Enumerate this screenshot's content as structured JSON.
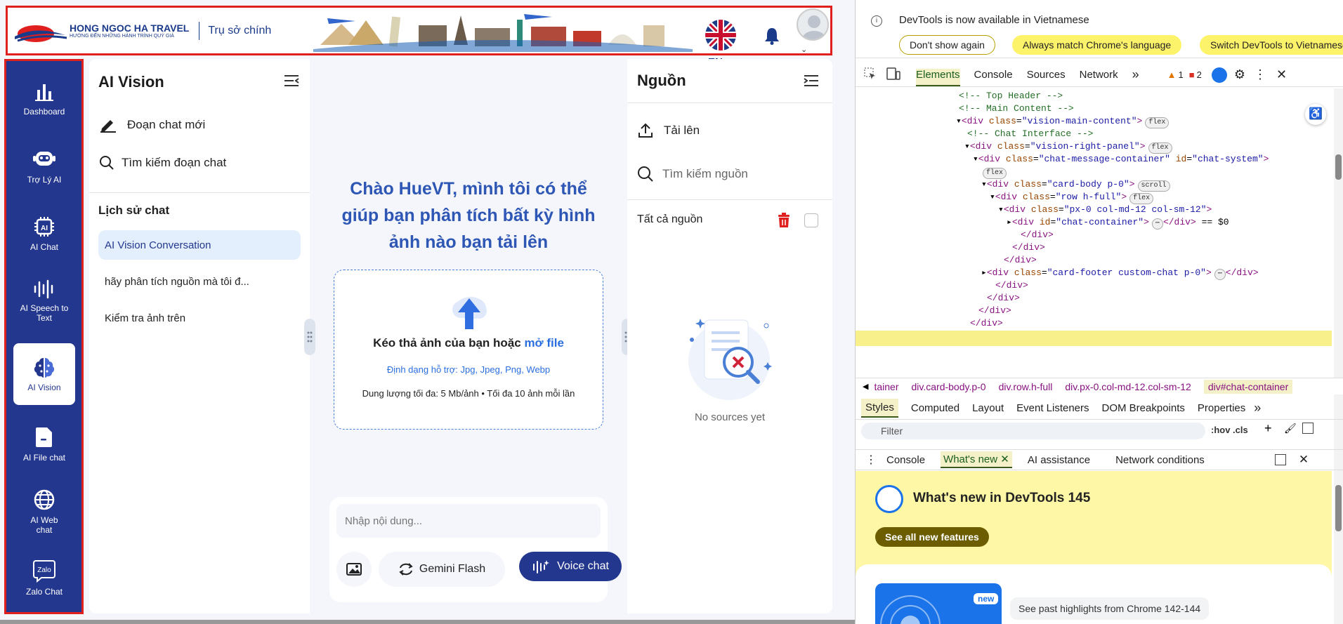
{
  "header": {
    "brand_name": "HONG NGOC HA TRAVEL",
    "brand_tagline": "HƯỚNG ĐẾN NHỮNG HÀNH TRÌNH QUÝ GIÁ",
    "office": "Trụ sở chính",
    "language": "EN"
  },
  "sidebar": {
    "items": [
      {
        "label": "Dashboard",
        "icon": "bar-chart-icon"
      },
      {
        "label": "Trợ Lý AI",
        "icon": "robot-icon"
      },
      {
        "label": "AI Chat",
        "icon": "ai-chip-icon"
      },
      {
        "label": "AI Speech to Text",
        "icon": "waveform-icon"
      },
      {
        "label": "AI Vision",
        "icon": "brain-icon"
      },
      {
        "label": "AI File chat",
        "icon": "file-icon"
      },
      {
        "label": "AI Web chat",
        "icon": "globe-icon"
      },
      {
        "label": "Zalo Chat",
        "icon": "zalo-icon"
      }
    ]
  },
  "vision_panel": {
    "title": "AI Vision",
    "new_chat": "Đoạn chat mới",
    "search_chat": "Tìm kiếm đoạn chat",
    "history_title": "Lịch sử chat",
    "history": [
      "AI Vision Conversation",
      "hãy phân tích nguồn mà tôi đ...",
      "Kiểm tra ảnh trên"
    ]
  },
  "center": {
    "greeting": "Chào HueVT, mình tôi có thể giúp bạn phân tích bất kỳ hình ảnh nào bạn tải lên",
    "drop_text": "Kéo thả ảnh của bạn hoặc ",
    "drop_link": "mở file",
    "formats": "Định dạng hỗ trợ: Jpg, Jpeg, Png, Webp",
    "limits": "Dung lượng tối đa: 5 Mb/ảnh • Tối đa 10 ảnh mỗi lần",
    "input_placeholder": "Nhập nội dung...",
    "model": "Gemini Flash",
    "voice": "Voice chat"
  },
  "sources": {
    "title": "Nguồn",
    "upload": "Tải lên",
    "search": "Tìm kiếm nguồn",
    "all": "Tất cả nguồn",
    "empty": "No sources yet"
  },
  "devtools": {
    "info": "DevTools is now available in Vietnamese",
    "btn_dont_show": "Don't show again",
    "btn_match": "Always match Chrome's language",
    "btn_switch": "Switch DevTools to Vietnamese",
    "tabs": [
      "Elements",
      "Console",
      "Sources",
      "Network"
    ],
    "warnings": "1",
    "errors": "2",
    "code_lines": [
      {
        "indent": 150,
        "html": "<span class='c-cm'>&lt;!-- Top Header --&gt;</span>"
      },
      {
        "indent": 150,
        "html": "<span class='c-cm'>&lt;!-- Main Content --&gt;</span>"
      },
      {
        "indent": 146,
        "html": "▾<span class='c-tag'>&lt;div</span> <span class='c-attr'>class</span>=<span class='c-val'>\"vision-main-content\"</span><span class='c-tag'>&gt;</span><span class='c-badge'>flex</span>"
      },
      {
        "indent": 162,
        "html": "<span class='c-cm'>&lt;!-- Chat Interface --&gt;</span>"
      },
      {
        "indent": 158,
        "html": "▾<span class='c-tag'>&lt;div</span> <span class='c-attr'>class</span>=<span class='c-val'>\"vision-right-panel\"</span><span class='c-tag'>&gt;</span><span class='c-badge'>flex</span>"
      },
      {
        "indent": 170,
        "html": "▾<span class='c-tag'>&lt;div</span> <span class='c-attr'>class</span>=<span class='c-val'>\"chat-message-container\"</span> <span class='c-attr'>id</span>=<span class='c-val'>\"chat-system\"</span><span class='c-tag'>&gt;</span>"
      },
      {
        "indent": 180,
        "html": "<span class='c-badge'>flex</span>"
      },
      {
        "indent": 182,
        "html": "▾<span class='c-tag'>&lt;div</span> <span class='c-attr'>class</span>=<span class='c-val'>\"card-body p-0\"</span><span class='c-tag'>&gt;</span><span class='c-badge'>scroll</span>"
      },
      {
        "indent": 194,
        "html": "▾<span class='c-tag'>&lt;div</span> <span class='c-attr'>class</span>=<span class='c-val'>\"row h-full\"</span><span class='c-tag'>&gt;</span><span class='c-badge'>flex</span>"
      },
      {
        "indent": 206,
        "html": "▾<span class='c-tag'>&lt;div</span> <span class='c-attr'>class</span>=<span class='c-val'>\"px-0 col-md-12 col-sm-12\"</span><span class='c-tag'>&gt;</span>"
      },
      {
        "indent": 218,
        "html": "▸<span class='c-tag'>&lt;div</span> <span class='c-attr'>id</span>=<span class='c-val'>\"chat-container\"</span><span class='c-tag'>&gt;</span><span class='c-badge'>⋯</span><span class='c-tag'>&lt;/div&gt;</span> == $0"
      },
      {
        "indent": 238,
        "html": "<span class='c-tag'>&lt;/div&gt;</span>"
      },
      {
        "indent": 226,
        "html": "<span class='c-tag'>&lt;/div&gt;</span>"
      },
      {
        "indent": 214,
        "html": "<span class='c-tag'>&lt;/div&gt;</span>"
      },
      {
        "indent": 182,
        "html": "▸<span class='c-tag'>&lt;div</span> <span class='c-attr'>class</span>=<span class='c-val'>\"card-footer custom-chat p-0\"</span><span class='c-tag'>&gt;</span><span class='c-badge'>⋯</span><span class='c-tag'>&lt;/div&gt;</span>"
      },
      {
        "indent": 202,
        "html": "<span class='c-tag'>&lt;/div&gt;</span>"
      },
      {
        "indent": 190,
        "html": "<span class='c-tag'>&lt;/div&gt;</span>"
      },
      {
        "indent": 178,
        "html": "<span class='c-tag'>&lt;/div&gt;</span>"
      },
      {
        "indent": 166,
        "html": "<span class='c-tag'>&lt;/div&gt;</span>"
      }
    ],
    "crumbs": [
      "tainer",
      "div.card-body.p-0",
      "div.row.h-full",
      "div.px-0.col-md-12.col-sm-12",
      "div#chat-container"
    ],
    "subtabs": [
      "Styles",
      "Computed",
      "Layout",
      "Event Listeners",
      "DOM Breakpoints",
      "Properties"
    ],
    "filter": "Filter",
    "hovcls": ":hov .cls",
    "drawer_tabs": [
      "Console",
      "What's new",
      "AI assistance",
      "Network conditions"
    ],
    "whats_new_title": "What's new in DevTools 145",
    "see_all": "See all new features",
    "new_badge": "new",
    "past": "See past highlights from Chrome 142-144"
  }
}
